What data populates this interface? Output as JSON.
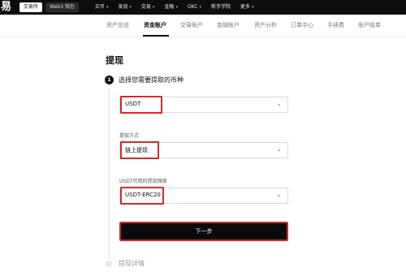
{
  "brand": {
    "glyph": "易"
  },
  "topbar": {
    "exchange_tab": "交易所",
    "web3_tab": "Web3 钱包",
    "nav": [
      {
        "label": "买币",
        "caret": true
      },
      {
        "label": "发现",
        "caret": true
      },
      {
        "label": "交易",
        "caret": true
      },
      {
        "label": "金融",
        "caret": true
      },
      {
        "label": "OKC",
        "caret": true
      },
      {
        "label": "新手学院",
        "caret": false
      },
      {
        "label": "更多",
        "caret": true
      }
    ]
  },
  "subnav": {
    "items": [
      "资产总览",
      "资金账户",
      "交易账户",
      "金融账户",
      "资产分析",
      "订单中心",
      "手续费",
      "账户结单"
    ],
    "active": "资金账户"
  },
  "page": {
    "title": "提现",
    "step1": {
      "number": "1",
      "title": "选择您需要提取的币种"
    },
    "coin_select": {
      "value": "USDT"
    },
    "method": {
      "label": "提现方式",
      "value": "链上提现"
    },
    "network": {
      "label": "USDT可用的提现网络",
      "value": "USDT-ERC20"
    },
    "next_button": "下一步",
    "step2": {
      "title": "提现详情"
    }
  },
  "colors": {
    "highlight": "#d42a2a",
    "nav_bg": "#0d0d0d",
    "button_bg": "#0a0a0a"
  }
}
